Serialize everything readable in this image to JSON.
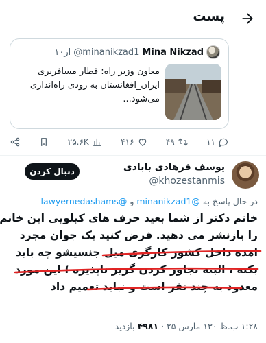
{
  "header": {
    "title": "پست"
  },
  "quoted": {
    "name": "Mina Nikzad",
    "handle": "@minanikzad1",
    "time": "۱۰ار",
    "text": "معاون وزیر راه: قطار مسافربری ایران_افغانستان به زودی راه‌اندازی می‌شود..."
  },
  "actions": {
    "replies": "۱۱",
    "retweets": "۴۹",
    "likes": "۴۱۶",
    "views": "۲۵.۶K"
  },
  "author": {
    "name": "یوسف فرهادی بابادی",
    "handle": "@khozestanmis",
    "follow_label": "دنبال کردن"
  },
  "reply_to": {
    "prefix": "در حال پاسخ به",
    "mention1": "@minanikzad1",
    "conj": "و",
    "mention2": "@lawyernedashams"
  },
  "body": {
    "line1": "خانم دکتر از شما بعید حرف های کیلویی این خانم",
    "line2": "را بازنشر می دهید. فرض کنید یک جوان مجرد",
    "line3": "امده داخل کشور کارگری میل جنسیشو چه باید",
    "line4": "بکنه ، البته تجاوز کردن گریز ناپذیره ؛ این مورد",
    "line5": "معدود به چند نفر است و نباید تعمیم داد"
  },
  "meta": {
    "time_date": "۱:۲۸ ب.ظ ۱۳۰ مارس ۲۵",
    "views_count": "۴۹۸۱",
    "views_label": "بازدید"
  },
  "colors": {
    "accent": "#1d9bf0",
    "annotation": "#e02424",
    "muted": "#536471"
  }
}
